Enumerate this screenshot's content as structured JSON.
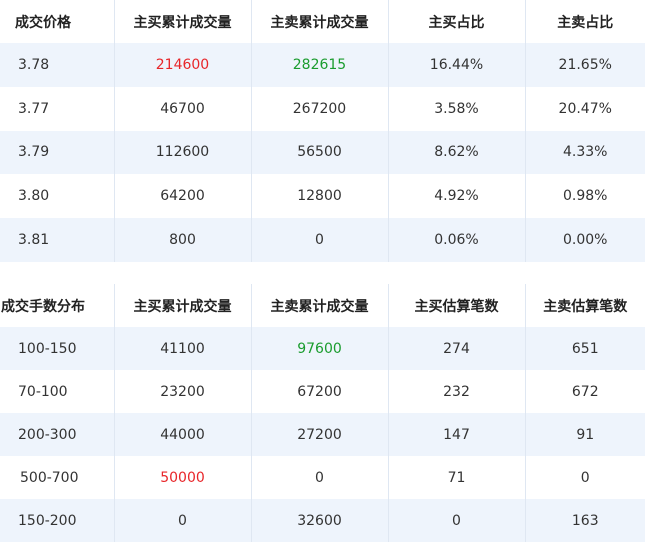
{
  "price_table": {
    "headers": [
      "成交价格",
      "主买累计成交量",
      "主卖累计成交量",
      "主买占比",
      "主卖占比"
    ],
    "rows": [
      {
        "price": "3.78",
        "buy_volume": "214600",
        "sell_volume": "282615",
        "buy_ratio": "16.44%",
        "sell_ratio": "21.65%"
      },
      {
        "price": "3.77",
        "buy_volume": "46700",
        "sell_volume": "267200",
        "buy_ratio": "3.58%",
        "sell_ratio": "20.47%"
      },
      {
        "price": "3.79",
        "buy_volume": "112600",
        "sell_volume": "56500",
        "buy_ratio": "8.62%",
        "sell_ratio": "4.33%"
      },
      {
        "price": "3.80",
        "buy_volume": "64200",
        "sell_volume": "12800",
        "buy_ratio": "4.92%",
        "sell_ratio": "0.98%"
      },
      {
        "price": "3.81",
        "buy_volume": "800",
        "sell_volume": "0",
        "buy_ratio": "0.06%",
        "sell_ratio": "0.00%"
      }
    ]
  },
  "lot_table": {
    "headers": [
      "成交手数分布",
      "主买累计成交量",
      "主卖累计成交量",
      "主买估算笔数",
      "主卖估算笔数"
    ],
    "rows": [
      {
        "range": "100-150",
        "buy_volume": "41100",
        "sell_volume": "97600",
        "buy_count": "274",
        "sell_count": "651"
      },
      {
        "range": "70-100",
        "buy_volume": "23200",
        "sell_volume": "67200",
        "buy_count": "232",
        "sell_count": "672"
      },
      {
        "range": "200-300",
        "buy_volume": "44000",
        "sell_volume": "27200",
        "buy_count": "147",
        "sell_count": "91"
      },
      {
        "range": "500-700",
        "buy_volume": "50000",
        "sell_volume": "0",
        "buy_count": "71",
        "sell_count": "0"
      },
      {
        "range": "150-200",
        "buy_volume": "0",
        "sell_volume": "32600",
        "buy_count": "0",
        "sell_count": "163"
      }
    ]
  },
  "colors": {
    "highlight_max_buy": "#e8262a",
    "highlight_max_sell": "#1a9c2e",
    "row_stripe": "#eef4fc",
    "text": "#333333"
  }
}
